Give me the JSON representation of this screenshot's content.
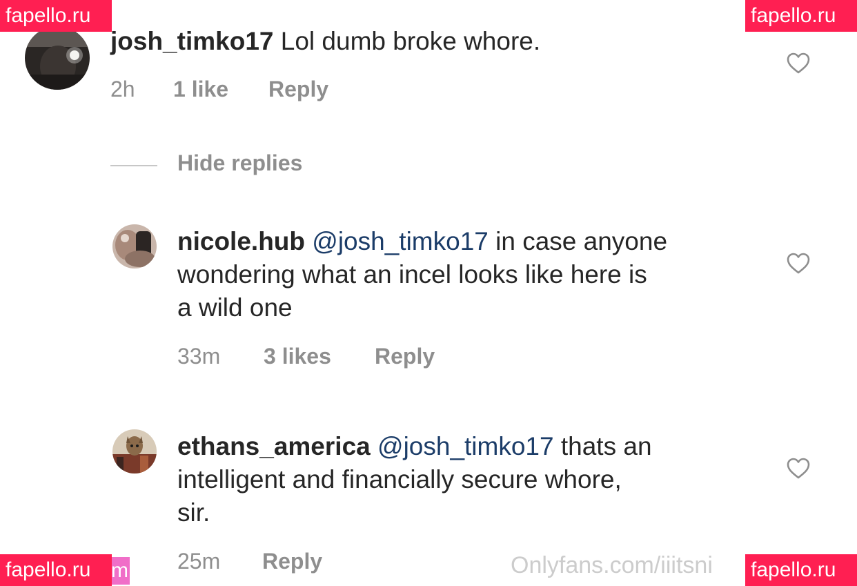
{
  "comments": [
    {
      "username": "josh_timko17",
      "mention": "",
      "text": " Lol dumb broke whore.",
      "time": "2h",
      "likes": "1 like",
      "reply_label": "Reply"
    },
    {
      "username": "nicole.hub",
      "mention": "@josh_timko17",
      "text_line1": " in case anyone",
      "text_line2": "wondering what an incel looks like here is",
      "text_line3": "a wild one",
      "time": "33m",
      "likes": "3 likes",
      "reply_label": "Reply"
    },
    {
      "username": "ethans_america",
      "mention": "@josh_timko17",
      "text_line1": " thats an",
      "text_line2": "intelligent and financially secure whore,",
      "text_line3": "sir.",
      "time": "25m",
      "reply_label": "Reply"
    }
  ],
  "hide_replies_label": "Hide replies",
  "watermarks": {
    "site": "fapello.ru",
    "onlyfans": "Onlyfans.com/iiitsni",
    "pink_fragment": "m"
  },
  "icons": {
    "like": "heart-outline-icon"
  },
  "colors": {
    "text": "#262626",
    "meta": "#8e8e8e",
    "mention": "#1b3c68",
    "watermark_bg": "#ff1f52"
  }
}
